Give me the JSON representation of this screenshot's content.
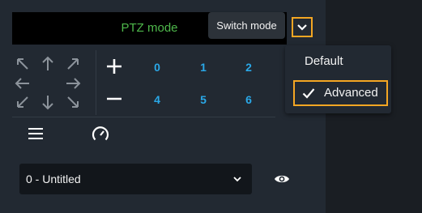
{
  "mode_bar": {
    "label": "PTZ mode",
    "label_color": "#4eb84b"
  },
  "tooltip": {
    "text": "Switch mode"
  },
  "switch_button": {
    "icon": "chevron-down-icon",
    "highlight_color": "#f4a623"
  },
  "dpad": {
    "arrows": [
      "arrow-up-left-icon",
      "arrow-up-icon",
      "arrow-up-right-icon",
      "arrow-left-icon",
      "arrow-right-icon",
      "arrow-down-left-icon",
      "arrow-down-icon",
      "arrow-down-right-icon"
    ]
  },
  "zoom": {
    "in_icon": "plus-icon",
    "out_icon": "minus-icon"
  },
  "presets": [
    "0",
    "1",
    "2",
    "4",
    "5",
    "6"
  ],
  "preset_color": "#2aa8e8",
  "toolbar": {
    "menu_icon": "hamburger-menu-icon",
    "speed_icon": "gauge-icon"
  },
  "tour_select": {
    "value": "0 - Untitled",
    "icon": "chevron-down-icon"
  },
  "visibility": {
    "icon": "eye-icon"
  },
  "mode_menu": {
    "items": [
      {
        "label": "Default",
        "selected": false
      },
      {
        "label": "Advanced",
        "selected": true
      }
    ]
  }
}
